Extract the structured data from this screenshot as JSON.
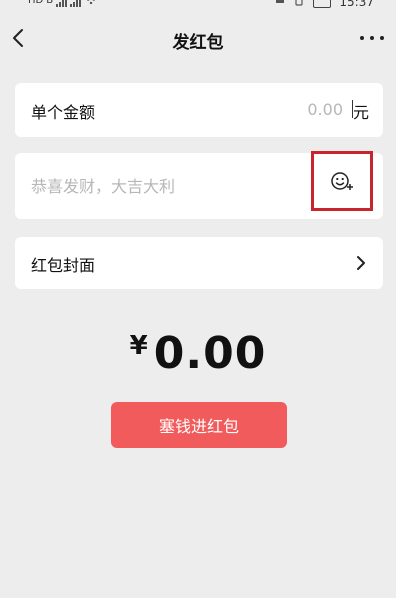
{
  "status_bar": {
    "left_badges": [
      "HD",
      "B"
    ],
    "time": "15:37"
  },
  "nav": {
    "back_icon": "chevron-left-icon",
    "title": "发红包",
    "more_icon": "more-dots-icon"
  },
  "amount": {
    "label": "单个金额",
    "placeholder": "0.00",
    "unit": "元"
  },
  "message": {
    "placeholder": "恭喜发财，大吉大利",
    "emoji_icon": "emoji-add-icon",
    "highlight_color": "#c8252c"
  },
  "cover": {
    "label": "红包封面",
    "chevron_icon": "chevron-right-icon"
  },
  "total": {
    "currency": "¥",
    "value": "0.00"
  },
  "send_button": {
    "label": "塞钱进红包",
    "color": "#f15b5b"
  },
  "colors": {
    "background": "#ededed",
    "card": "#ffffff",
    "placeholder": "#b7b7b7"
  }
}
